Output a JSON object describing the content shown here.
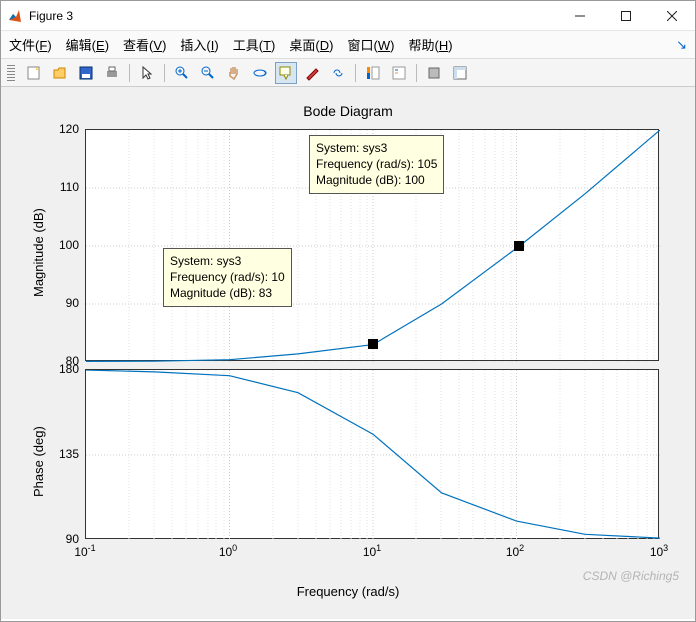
{
  "window": {
    "title": "Figure 3"
  },
  "menus": {
    "file": {
      "label": "文件",
      "accel": "F"
    },
    "edit": {
      "label": "编辑",
      "accel": "E"
    },
    "view": {
      "label": "查看",
      "accel": "V"
    },
    "insert": {
      "label": "插入",
      "accel": "I"
    },
    "tools": {
      "label": "工具",
      "accel": "T"
    },
    "desktop": {
      "label": "桌面",
      "accel": "D"
    },
    "window": {
      "label": "窗口",
      "accel": "W"
    },
    "help": {
      "label": "帮助",
      "accel": "H"
    }
  },
  "chart": {
    "title": "Bode Diagram",
    "xlabel": "Frequency  (rad/s)",
    "mag_ylabel": "Magnitude (dB)",
    "phase_ylabel": "Phase (deg)"
  },
  "datatip1": {
    "l1": "System: sys3",
    "l2": "Frequency (rad/s): 105",
    "l3": "Magnitude (dB): 100"
  },
  "datatip2": {
    "l1": "System: sys3",
    "l2": "Frequency (rad/s): 10",
    "l3": "Magnitude (dB): 83"
  },
  "yticks_mag": {
    "t0": "80",
    "t1": "90",
    "t2": "100",
    "t3": "110",
    "t4": "120"
  },
  "yticks_phase": {
    "t0": "90",
    "t1": "135",
    "t2": "180"
  },
  "xticks": {
    "t0": "-1",
    "t1": "0",
    "t2": "1",
    "t3": "2",
    "t4": "3"
  },
  "watermark": "CSDN @Riching5",
  "chart_data": {
    "type": "line",
    "title": "Bode Diagram",
    "xlabel": "Frequency (rad/s)",
    "x_scale": "log",
    "xlim": [
      0.1,
      1000
    ],
    "panels": [
      {
        "name": "Magnitude",
        "ylabel": "Magnitude (dB)",
        "ylim": [
          80,
          120
        ],
        "series": [
          {
            "name": "sys3",
            "x": [
              0.1,
              0.3,
              1,
              3,
              10,
              30,
              105,
              300,
              1000
            ],
            "y": [
              80,
              80.1,
              80.4,
              81.4,
              83,
              90,
              100,
              109,
              120
            ]
          }
        ],
        "markers": [
          {
            "x": 10,
            "y": 83,
            "label": "System: sys3; Frequency (rad/s): 10; Magnitude (dB): 83"
          },
          {
            "x": 105,
            "y": 100,
            "label": "System: sys3; Frequency (rad/s): 105; Magnitude (dB): 100"
          }
        ]
      },
      {
        "name": "Phase",
        "ylabel": "Phase (deg)",
        "ylim": [
          90,
          180
        ],
        "series": [
          {
            "name": "sys3",
            "x": [
              0.1,
              0.3,
              1,
              3,
              10,
              30,
              100,
              300,
              1000
            ],
            "y": [
              180,
              179,
              177,
              168,
              146,
              115,
              100,
              93,
              91
            ]
          }
        ]
      }
    ]
  }
}
